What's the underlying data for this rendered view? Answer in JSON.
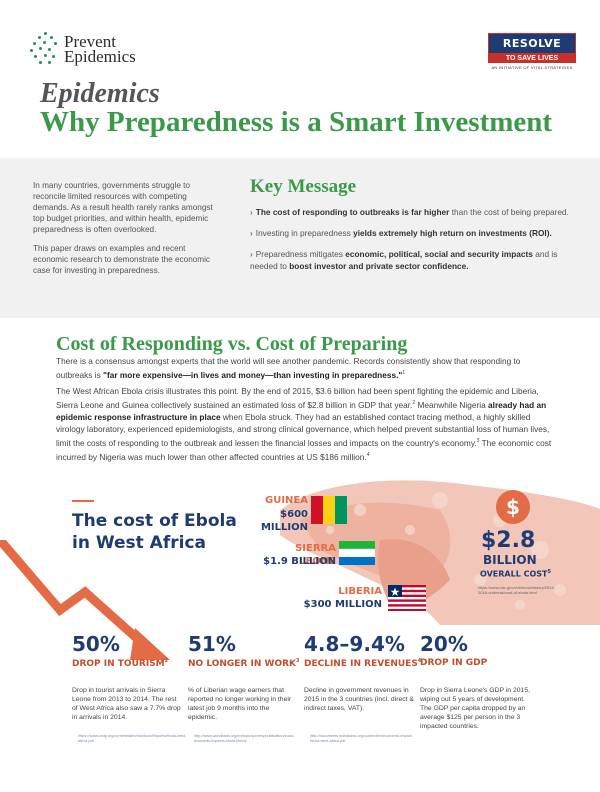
{
  "header": {
    "brand_line1": "Prevent",
    "brand_line2": "Epidemics",
    "partner_name": "RESOLVE",
    "partner_tagline": "TO SAVE LIVES",
    "partner_subtext": "AN INITIATIVE OF VITAL STRATEGIES",
    "title_line1": "Epidemics",
    "title_line2": "Why  Preparedness is a Smart Investment"
  },
  "intro": {
    "p1": "In many countries, governments struggle to reconcile limited resources with competing demands. As a result health rarely ranks amongst top budget priorities, and within health, epidemic preparedness is often overlooked.",
    "p2": "This paper draws on examples and recent economic research to demonstrate the economic case for investing in preparedness."
  },
  "key_message": {
    "title": "Key Message",
    "item1_bold": "The cost of responding to outbreaks is far higher",
    "item1_rest": " than the cost of being prepared.",
    "item2_pre": "Investing in preparedness ",
    "item2_bold": "yields extremely high return on investments (ROI).",
    "item3_pre": "Preparedness mitigates ",
    "item3_bold": "economic, political, social and security impacts",
    "item3_mid": " and is needed to ",
    "item3_bold2": "boost investor and private sector confidence."
  },
  "cost_section": {
    "heading": "Cost of Responding vs. Cost of Preparing",
    "p1_pre": "There is a consensus amongst experts that the world will see another pandemic. Records consistently show that responding to outbreaks is ",
    "p1_bold": "\"far more expensive—in lives and money—than investing in preparedness.\"",
    "p1_sup": "1",
    "p2_a": "The West African Ebola crisis illustrates this point. By the end of 2015, $3.6 billion had been spent fighting the epidemic and Liberia, Sierra Leone and Guinea collectively sustained an estimated loss of $2.8 billion in GDP that year.",
    "p2_sup1": "2",
    "p2_b": " Meanwhile Nigeria ",
    "p2_bold": "already had an epidemic response infrastructure in place",
    "p2_c": " when Ebola struck. They had an established contact tracing method, a highly skilled virology laboratory, experienced epidemiologists, and strong clinical governance, which helped prevent substantial loss of human lives, limit the costs of responding to the outbreak and lessen the financial losses and impacts on the country's economy.",
    "p2_sup2": "3",
    "p2_d": " The economic cost incurred by Nigeria was much lower than other affected countries at US $186 million.",
    "p2_sup3": "4"
  },
  "infographic": {
    "title_line1": "The cost of Ebola",
    "title_line2": "in West Africa",
    "guinea_name": "GUINEA",
    "guinea_value": "$600 MILLION",
    "sierra_name": "SIERRA LEONE",
    "sierra_value": "$1.9 BILLION",
    "liberia_name": "LIBERIA",
    "liberia_value": "$300 MILLION",
    "dollar_symbol": "$",
    "total_value": "$2.8",
    "total_unit": "BILLION",
    "total_label": "OVERALL COST",
    "total_sup": "5",
    "total_source": "https://www.cdc.gov/vhf/ebola/history/2014-2016-outbreak/cost-of-ebola.html",
    "colors": {
      "navy": "#1f3b73",
      "orange": "#e36b45",
      "green": "#3a9a4a"
    }
  },
  "stats": [
    {
      "value": "50%",
      "label": "DROP IN TOURISM",
      "sup": "2",
      "desc": "Drop in tourist arrivals in Sierra Leone from 2013 to 2014. The rest of West Africa also saw a 7.7% drop in arrivals in 2014.",
      "source": "https://www.undp.org/content/dam/rba/docs/Reports/ebola-west-africa.pdf"
    },
    {
      "value": "51%",
      "label": "NO LONGER IN WORK",
      "sup": "3",
      "desc": "% of Liberian wage earners that reported no longer working in their latest job 9 months into the epidemic.",
      "source": "http://www.worldbank.org/en/topic/poverty/publication/socio-economic-impacts-ebola-liberia"
    },
    {
      "value": "4.8–9.4%",
      "label": "DECLINE IN REVENUES",
      "sup": "4",
      "desc": "Decline in government revenues in 2015 in the 3 countries (incl. direct & indirect taxes, VAT).",
      "source": "http://documents.worldbank.org/curated/en/economic-impact-ebola-west-africa.pdf"
    },
    {
      "value": "20%",
      "label": "DROP IN GDP",
      "sup": "",
      "desc": "Drop in Sierra Leone's GDP in 2015, wiping out 5 years of development. The GDP per capita dropped by an average $125 per person in the 3 impacted countries.",
      "source": ""
    }
  ]
}
